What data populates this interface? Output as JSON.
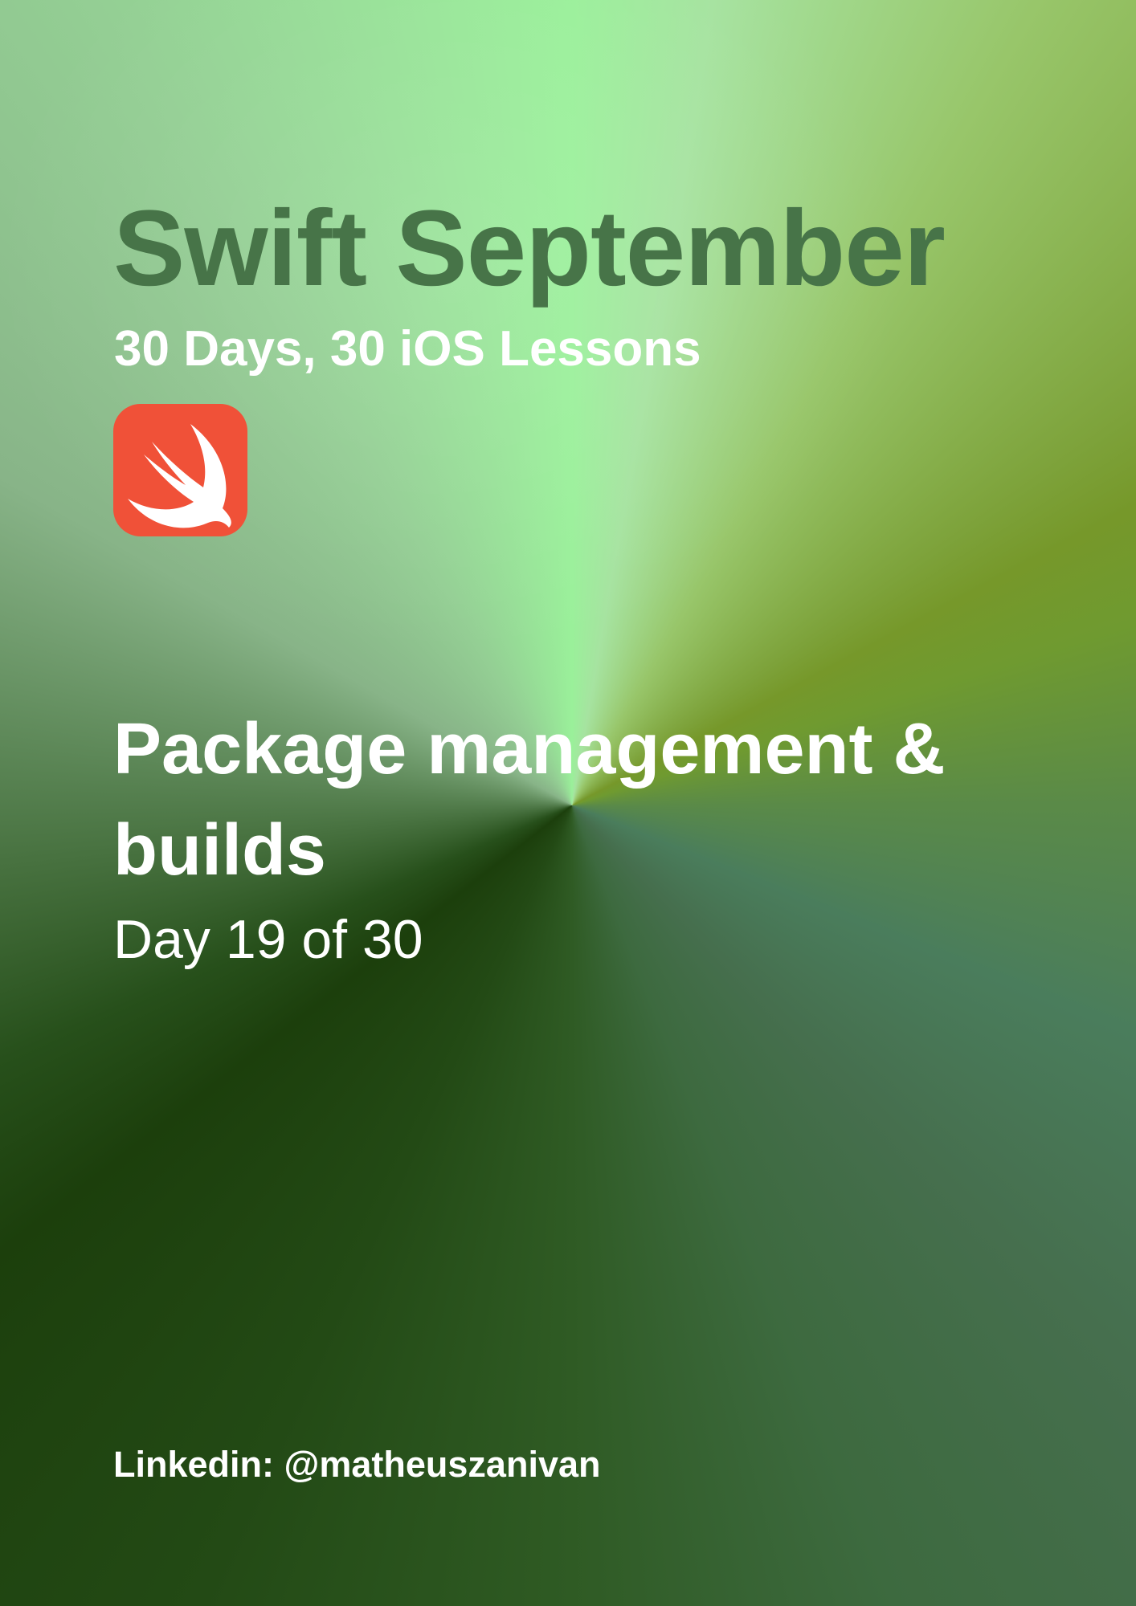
{
  "header": {
    "title": "Swift September",
    "subtitle": "30 Days, 30 iOS Lessons",
    "logo_icon": "swift-logo-icon",
    "logo_color": "#f05138"
  },
  "lesson": {
    "title": "Package management & builds",
    "progress": "Day 19 of 30"
  },
  "footer": {
    "social": "Linkedin: @matheuszanivan"
  },
  "colors": {
    "title": "#477448",
    "text": "#ffffff"
  }
}
